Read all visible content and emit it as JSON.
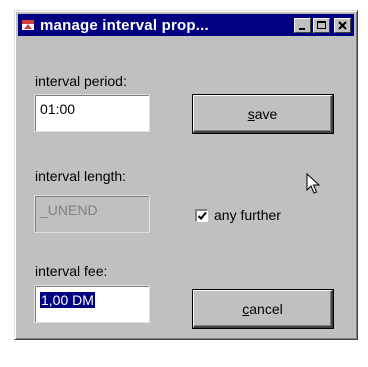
{
  "window": {
    "title": "manage interval prop...",
    "colors": {
      "face": "#c0c0c0",
      "titlebar": "#000080",
      "selection": "#000080",
      "icon": "#d04040"
    }
  },
  "titlebar_buttons": [
    "minimize-icon",
    "maximize-icon",
    "close-icon"
  ],
  "form": {
    "period_label": "interval period:",
    "period_value": "01:00",
    "length_label": "interval length:",
    "length_value": "_UNEND",
    "fee_label": "interval fee:",
    "fee_value": "1,00 DM",
    "any_further_label": "any further",
    "any_further_checked": true
  },
  "buttons": {
    "save_mnemonic": "s",
    "save_rest": "ave",
    "cancel_mnemonic": "c",
    "cancel_rest": "ancel"
  },
  "cursor": "arrow-pointer-icon"
}
